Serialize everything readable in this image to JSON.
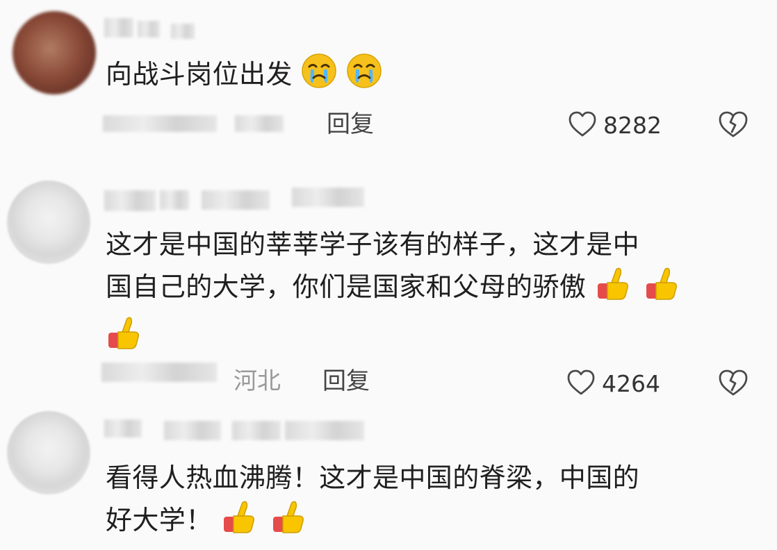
{
  "comments": [
    {
      "lines": [
        "向战斗岗位出发"
      ],
      "emojis": [
        "crying-face",
        "crying-face"
      ],
      "region": "",
      "reply_label": "回复",
      "likes": "8282"
    },
    {
      "lines": [
        "这才是中国的莘莘学子该有的样子，这才是中",
        "国自己的大学，你们是国家和父母的骄傲"
      ],
      "emojis": [
        "thumbs-up",
        "thumbs-up",
        "thumbs-up"
      ],
      "region": "河北",
      "reply_label": "回复",
      "likes": "4264"
    },
    {
      "lines": [
        "看得人热血沸腾！这才是中国的脊梁，中国的",
        "好大学！"
      ],
      "emojis": [
        "thumbs-up",
        "thumbs-up"
      ]
    }
  ],
  "colors": {
    "background": "#fafafa",
    "text": "#1f1f1f",
    "meta": "#444444",
    "region": "#9a9a9a",
    "emoji_yellow": "#f8c500",
    "emoji_red": "#e55a4d"
  }
}
